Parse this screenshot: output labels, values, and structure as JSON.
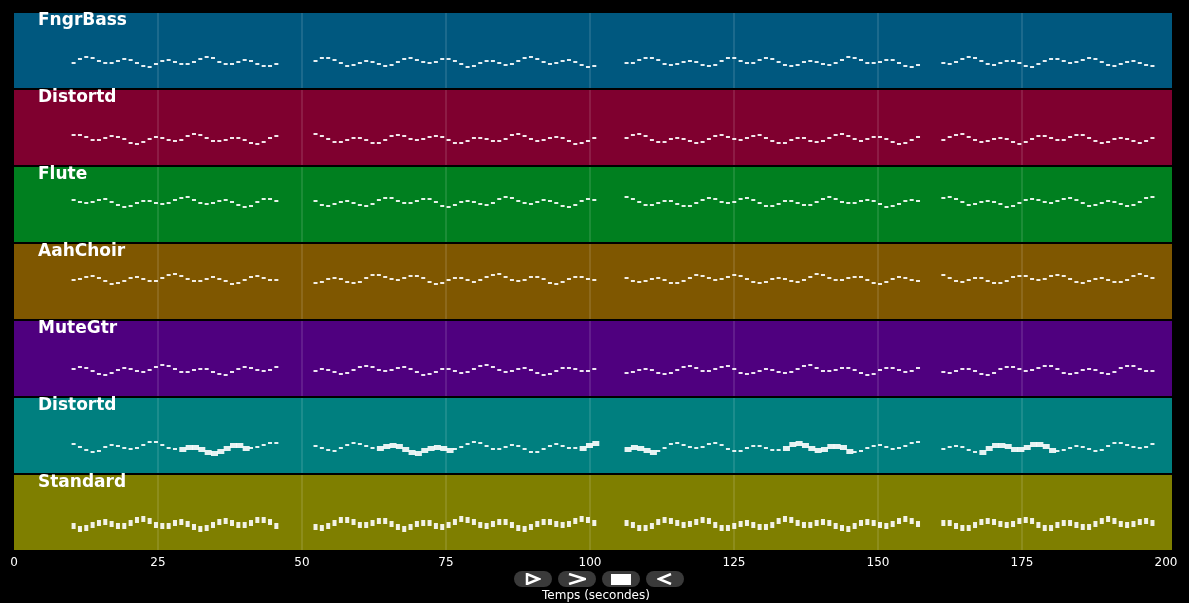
{
  "tracks": [
    {
      "name": "FngrBass",
      "color": "#00587f"
    },
    {
      "name": "Distortd",
      "color": "#7f002f"
    },
    {
      "name": "Flute",
      "color": "#007f1f"
    },
    {
      "name": "AahChoir",
      "color": "#7f5700"
    },
    {
      "name": "MuteGtr",
      "color": "#4f007f"
    },
    {
      "name": "Distortd",
      "color": "#007f7f"
    },
    {
      "name": "Standard",
      "color": "#7f7f00"
    }
  ],
  "x_axis": {
    "ticks": [
      "0",
      "25",
      "50",
      "75",
      "100",
      "125",
      "150",
      "175",
      "200"
    ],
    "label": "Temps (secondes)"
  }
}
